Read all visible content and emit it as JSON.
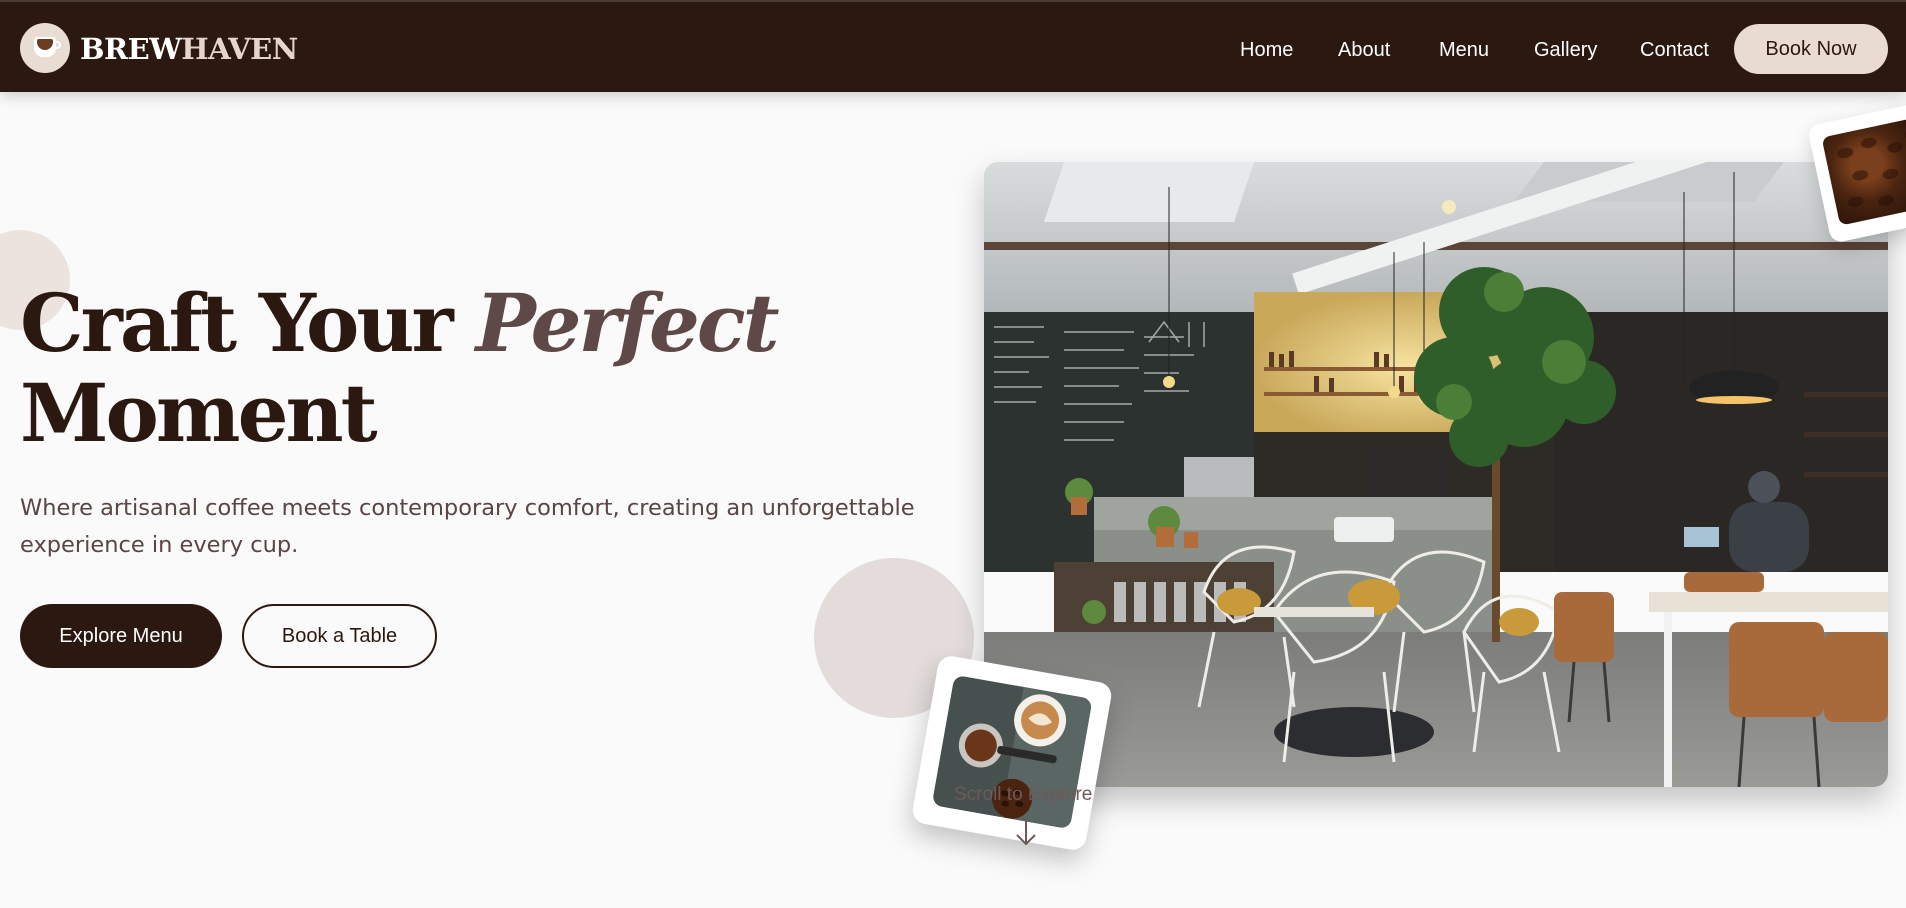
{
  "brand": {
    "name_part1": "BREW",
    "name_part2": "HAVEN",
    "logo_icon": "coffee-cup-icon"
  },
  "nav": {
    "links": [
      "Home",
      "About",
      "Menu",
      "Gallery",
      "Contact"
    ],
    "cta": "Book Now"
  },
  "hero": {
    "title_line1_plain": "Craft Your ",
    "title_line1_accent": "Perfect",
    "title_line2": "Moment",
    "subtitle": "Where artisanal coffee meets contemporary comfort, creating an unforgettable experience in every cup.",
    "primary_button": "Explore Menu",
    "secondary_button": "Book a Table"
  },
  "scroll_hint": {
    "label": "Scroll to Explore",
    "icon": "arrow-down-icon"
  },
  "colors": {
    "navbar": "#2b1810",
    "accent_light": "#eadbd1",
    "title_dark": "#2b1810",
    "title_accent": "#5f4848",
    "body_text": "#5a4545",
    "background": "#fafafa"
  }
}
